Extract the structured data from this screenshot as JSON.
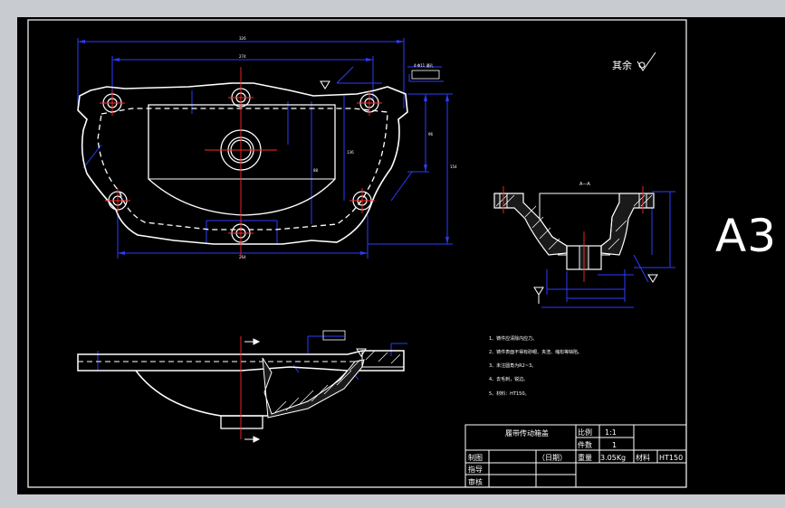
{
  "sheet": {
    "size_label": "A3"
  },
  "surface_finish": {
    "label": "其余"
  },
  "section_view": {
    "label": "A—A"
  },
  "tech_notes": {
    "items": [
      "1、铸件应清除内应力。",
      "2、铸件表面不得有砂眼、夹渣、缩松等缺陷。",
      "3、未注圆角为R2~3。",
      "4、去毛刺，锐边。",
      "5、材料：HT150。"
    ]
  },
  "title_block": {
    "part_name": "履带传动箱盖",
    "scale_label": "比例",
    "scale_value": "1:1",
    "quantity_label": "件数",
    "quantity_value": "1",
    "drawn_label": "制图",
    "date_label": "（日期）",
    "weight_label": "重量",
    "weight_value": "3.05Kg",
    "material_label": "材料",
    "material_value": "HT150",
    "guide_label": "指导",
    "review_label": "审核"
  }
}
